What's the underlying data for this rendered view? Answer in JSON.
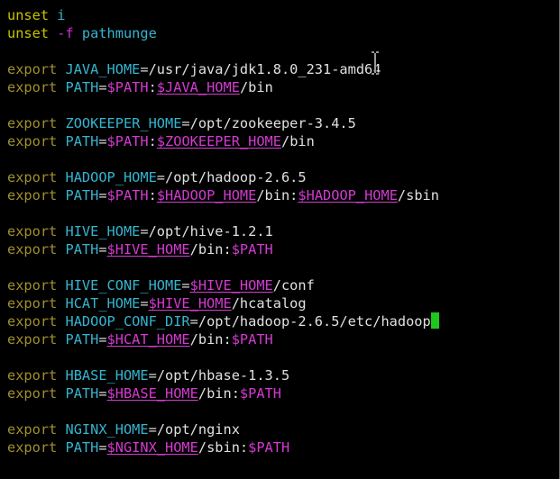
{
  "terminal": {
    "lines": [
      [
        {
          "t": "unset",
          "c": "kwd"
        },
        {
          "t": " ",
          "c": "op"
        },
        {
          "t": "i",
          "c": "ident"
        }
      ],
      [
        {
          "t": "unset",
          "c": "kwd"
        },
        {
          "t": " ",
          "c": "op"
        },
        {
          "t": "-f",
          "c": "flag"
        },
        {
          "t": " ",
          "c": "op"
        },
        {
          "t": "pathmunge",
          "c": "ident"
        }
      ],
      [],
      [
        {
          "t": "export",
          "c": "kw2"
        },
        {
          "t": " ",
          "c": "op"
        },
        {
          "t": "JAVA_HOME",
          "c": "ident"
        },
        {
          "t": "=",
          "c": "op"
        },
        {
          "t": "/usr/java/jdk1.8.0_231-amd64",
          "c": "path"
        }
      ],
      [
        {
          "t": "export",
          "c": "kw2"
        },
        {
          "t": " ",
          "c": "op"
        },
        {
          "t": "PATH",
          "c": "ident"
        },
        {
          "t": "=",
          "c": "op"
        },
        {
          "t": "$PATH",
          "c": "var"
        },
        {
          "t": ":",
          "c": "op"
        },
        {
          "t": "$JAVA_HOME",
          "c": "var ul"
        },
        {
          "t": "/bin",
          "c": "path"
        }
      ],
      [],
      [
        {
          "t": "export",
          "c": "kw2"
        },
        {
          "t": " ",
          "c": "op"
        },
        {
          "t": "ZOOKEEPER_HOME",
          "c": "ident"
        },
        {
          "t": "=",
          "c": "op"
        },
        {
          "t": "/opt/zookeeper-3.4.5",
          "c": "path"
        }
      ],
      [
        {
          "t": "export",
          "c": "kw2"
        },
        {
          "t": " ",
          "c": "op"
        },
        {
          "t": "PATH",
          "c": "ident"
        },
        {
          "t": "=",
          "c": "op"
        },
        {
          "t": "$PATH",
          "c": "var"
        },
        {
          "t": ":",
          "c": "op"
        },
        {
          "t": "$ZOOKEEPER_HOME",
          "c": "var ul"
        },
        {
          "t": "/bin",
          "c": "path"
        }
      ],
      [],
      [
        {
          "t": "export",
          "c": "kw2"
        },
        {
          "t": " ",
          "c": "op"
        },
        {
          "t": "HADOOP_HOME",
          "c": "ident"
        },
        {
          "t": "=",
          "c": "op"
        },
        {
          "t": "/opt/hadoop-2.6.5",
          "c": "path"
        }
      ],
      [
        {
          "t": "export",
          "c": "kw2"
        },
        {
          "t": " ",
          "c": "op"
        },
        {
          "t": "PATH",
          "c": "ident"
        },
        {
          "t": "=",
          "c": "op"
        },
        {
          "t": "$PATH",
          "c": "var"
        },
        {
          "t": ":",
          "c": "op"
        },
        {
          "t": "$HADOOP_HOME",
          "c": "var ul"
        },
        {
          "t": "/bin:",
          "c": "path"
        },
        {
          "t": "$HADOOP_HOME",
          "c": "var ul"
        },
        {
          "t": "/sbin",
          "c": "path"
        }
      ],
      [],
      [
        {
          "t": "export",
          "c": "kw2"
        },
        {
          "t": " ",
          "c": "op"
        },
        {
          "t": "HIVE_HOME",
          "c": "ident"
        },
        {
          "t": "=",
          "c": "op"
        },
        {
          "t": "/opt/hive-1.2.1",
          "c": "path"
        }
      ],
      [
        {
          "t": "export",
          "c": "kw2"
        },
        {
          "t": " ",
          "c": "op"
        },
        {
          "t": "PATH",
          "c": "ident"
        },
        {
          "t": "=",
          "c": "op"
        },
        {
          "t": "$HIVE_HOME",
          "c": "var ul"
        },
        {
          "t": "/bin:",
          "c": "path"
        },
        {
          "t": "$PATH",
          "c": "var"
        }
      ],
      [],
      [
        {
          "t": "export",
          "c": "kw2"
        },
        {
          "t": " ",
          "c": "op"
        },
        {
          "t": "HIVE_CONF_HOME",
          "c": "ident"
        },
        {
          "t": "=",
          "c": "op"
        },
        {
          "t": "$HIVE_HOME",
          "c": "var ul"
        },
        {
          "t": "/conf",
          "c": "path"
        }
      ],
      [
        {
          "t": "export",
          "c": "kw2"
        },
        {
          "t": " ",
          "c": "op"
        },
        {
          "t": "HCAT_HOME",
          "c": "ident"
        },
        {
          "t": "=",
          "c": "op"
        },
        {
          "t": "$HIVE_HOME",
          "c": "var ul"
        },
        {
          "t": "/hcatalog",
          "c": "path"
        }
      ],
      [
        {
          "t": "export",
          "c": "kw2"
        },
        {
          "t": " ",
          "c": "op"
        },
        {
          "t": "HADOOP_CONF_DIR",
          "c": "ident"
        },
        {
          "t": "=",
          "c": "op"
        },
        {
          "t": "/opt/hadoop-2.6.5/etc/hadoop",
          "c": "path"
        },
        {
          "t": "",
          "c": "cursor"
        }
      ],
      [
        {
          "t": "export",
          "c": "kw2"
        },
        {
          "t": " ",
          "c": "op"
        },
        {
          "t": "PATH",
          "c": "ident"
        },
        {
          "t": "=",
          "c": "op"
        },
        {
          "t": "$HCAT_HOME",
          "c": "var ul"
        },
        {
          "t": "/bin:",
          "c": "path"
        },
        {
          "t": "$PATH",
          "c": "var"
        }
      ],
      [],
      [
        {
          "t": "export",
          "c": "kw2"
        },
        {
          "t": " ",
          "c": "op"
        },
        {
          "t": "HBASE_HOME",
          "c": "ident"
        },
        {
          "t": "=",
          "c": "op"
        },
        {
          "t": "/opt/hbase-1.3.5",
          "c": "path"
        }
      ],
      [
        {
          "t": "export",
          "c": "kw2"
        },
        {
          "t": " ",
          "c": "op"
        },
        {
          "t": "PATH",
          "c": "ident"
        },
        {
          "t": "=",
          "c": "op"
        },
        {
          "t": "$HBASE_HOME",
          "c": "var ul"
        },
        {
          "t": "/bin:",
          "c": "path"
        },
        {
          "t": "$PATH",
          "c": "var"
        }
      ],
      [],
      [
        {
          "t": "export",
          "c": "kw2"
        },
        {
          "t": " ",
          "c": "op"
        },
        {
          "t": "NGINX_HOME",
          "c": "ident"
        },
        {
          "t": "=",
          "c": "op"
        },
        {
          "t": "/opt/nginx",
          "c": "path"
        }
      ],
      [
        {
          "t": "export",
          "c": "kw2"
        },
        {
          "t": " ",
          "c": "op"
        },
        {
          "t": "PATH",
          "c": "ident"
        },
        {
          "t": "=",
          "c": "op"
        },
        {
          "t": "$NGINX_HOME",
          "c": "var ul"
        },
        {
          "t": "/sbin:",
          "c": "path"
        },
        {
          "t": "$PATH",
          "c": "var"
        }
      ]
    ]
  },
  "colors": {
    "background": "#000000",
    "keyword": "#a08f2d",
    "identifier": "#35b4cf",
    "variable": "#d33bd0",
    "path": "#e0e0e0",
    "cursor": "#1ec71e"
  },
  "mouse": {
    "icon": "text-ibeam-icon"
  }
}
